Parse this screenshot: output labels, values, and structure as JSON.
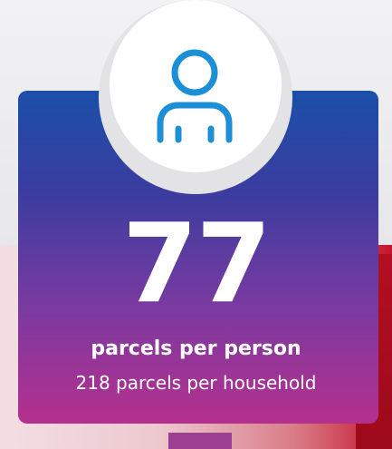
{
  "stat": {
    "value": "77",
    "primary_label": "parcels per person",
    "secondary_label": "218 parcels per household"
  },
  "icon": {
    "name": "person-icon",
    "color": "#1c8fd6"
  },
  "colors": {
    "card_top": "#1b4faa",
    "card_bottom": "#b5308e",
    "accent_red": "#c4162d"
  }
}
